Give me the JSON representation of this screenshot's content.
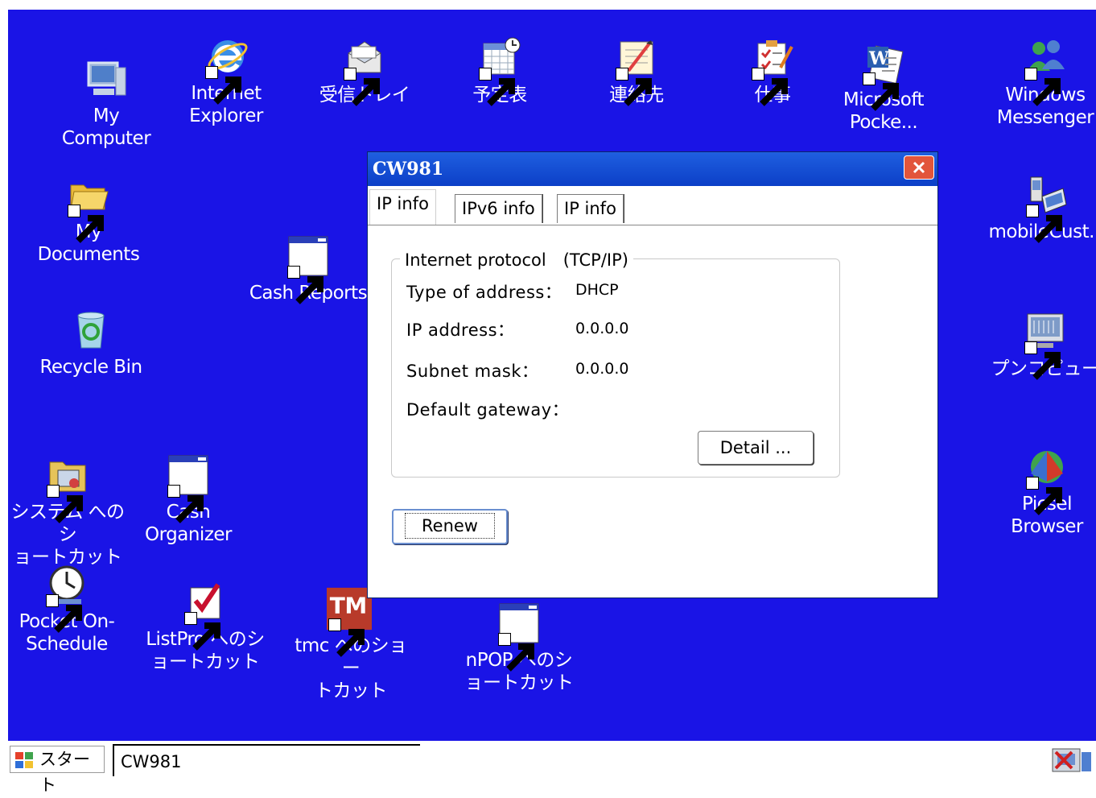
{
  "desktop": {
    "icons": [
      {
        "label": "My\nComputer",
        "icon": "computer-icon"
      },
      {
        "label": "Internet\nExplorer",
        "icon": "internet-explorer-icon"
      },
      {
        "label": "受信トレイ",
        "icon": "inbox-icon"
      },
      {
        "label": "予定表",
        "icon": "calendar-icon"
      },
      {
        "label": "連絡先",
        "icon": "contacts-icon"
      },
      {
        "label": "仕事",
        "icon": "tasks-icon"
      },
      {
        "label": "Microsoft\nPocke...",
        "icon": "word-icon"
      },
      {
        "label": "Windows\nMessenger",
        "icon": "messenger-icon"
      },
      {
        "label": "My\nDocuments",
        "icon": "folder-icon"
      },
      {
        "label": "Cash Reports",
        "icon": "app-window-icon"
      },
      {
        "label": "mobileCust...",
        "icon": "mobile-device-icon"
      },
      {
        "label": "Recycle Bin",
        "icon": "recycle-bin-icon"
      },
      {
        "label": "プンコピュー",
        "icon": "monitor-icon"
      },
      {
        "label": "システム へのシ\nョートカット",
        "icon": "system-icon"
      },
      {
        "label": "Cash\nOrganizer",
        "icon": "app-window-icon"
      },
      {
        "label": "Picsel\nBrowser",
        "icon": "picsel-icon"
      },
      {
        "label": "Pocket On-\nSchedule",
        "icon": "clock-icon"
      },
      {
        "label": "ListPro へのシ\nョートカット",
        "icon": "checklist-icon"
      },
      {
        "label": "tmc へのショー\nトカット",
        "icon": "tm-icon"
      },
      {
        "label": "nPOP へのシ\nョートカット",
        "icon": "app-window-icon"
      }
    ]
  },
  "window": {
    "title": "CW981",
    "tabs": [
      "IP info",
      "IPv6  info",
      "IP info"
    ],
    "group_title": "Internet protocol　(TCP/IP)",
    "fields": {
      "type_label": "Type of address：",
      "type_value": "DHCP",
      "ip_label": "IP address：",
      "ip_value": "0.0.0.0",
      "subnet_label": "Subnet mask：",
      "subnet_value": "0.0.0.0",
      "gateway_label": "Default gateway："
    },
    "detail_button": "Detail ...",
    "renew_button": "Renew"
  },
  "taskbar": {
    "start_label": "スタート",
    "task_label": "CW981"
  },
  "colors": {
    "desktop": "#1a14e6",
    "titlebar": "#0c3fc7",
    "close": "#e2553b"
  }
}
